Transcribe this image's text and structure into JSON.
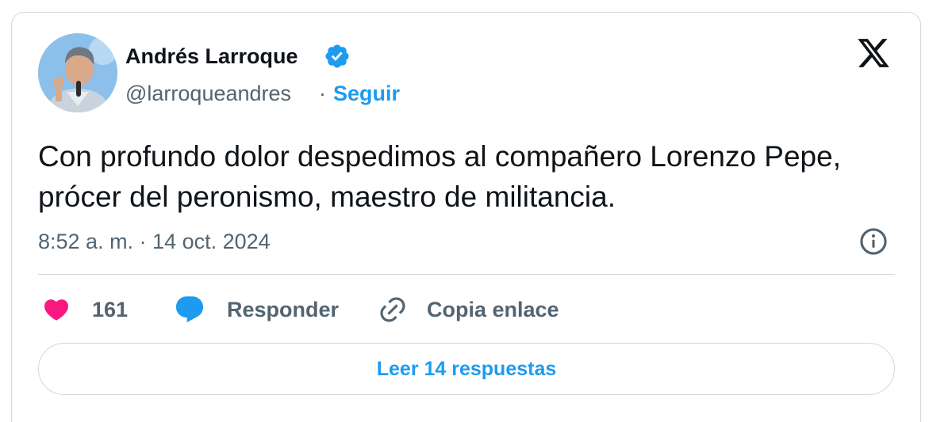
{
  "author": {
    "name": "Andrés Larroque",
    "handle": "@larroqueandres",
    "separator": "·",
    "follow_label": "Seguir"
  },
  "icons": {
    "verified": "verified-badge-icon",
    "brand": "x-logo-icon",
    "info": "info-icon",
    "like": "heart-icon",
    "reply": "speech-bubble-icon",
    "copy": "link-icon"
  },
  "tweet": {
    "text": "Con profundo dolor despedimos al compañero Lorenzo Pepe, prócer del peronismo, maestro de militancia.",
    "timestamp": "8:52 a. m. · 14 oct. 2024"
  },
  "actions": {
    "like_count": "161",
    "reply_label": "Responder",
    "copy_label": "Copia enlace"
  },
  "footer": {
    "read_replies_label": "Leer 14 respuestas"
  },
  "colors": {
    "accent": "#1d9bf0",
    "like": "#f91880",
    "text": "#0f1419",
    "muted": "#536471",
    "border": "#cfd9de"
  }
}
